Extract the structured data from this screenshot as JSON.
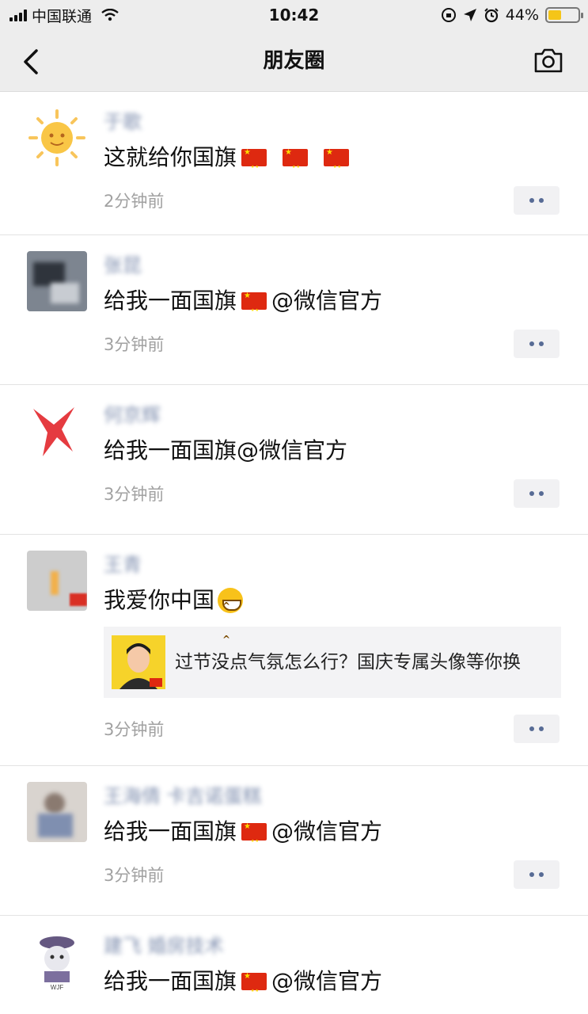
{
  "status_bar": {
    "carrier": "中国联通",
    "time": "10:42",
    "battery_text": "44%",
    "battery_level": 0.44
  },
  "nav": {
    "title": "朋友圈",
    "back_icon": "chevron-left-icon",
    "camera_icon": "camera-icon"
  },
  "posts": [
    {
      "author": "于歌",
      "content": "这就给你国旗",
      "flags": 3,
      "time": "2分钟前"
    },
    {
      "author": "张昆",
      "content_before": "给我一面国旗",
      "content_after": " @微信官方",
      "time": "3分钟前"
    },
    {
      "author": "何京辉",
      "content": "给我一面国旗@微信官方",
      "time": "3分钟前"
    },
    {
      "author": "王青",
      "content": "我爱你中国",
      "link_title": "过节没点气氛怎么行？国庆专属头像等你换",
      "time": "3分钟前"
    },
    {
      "author": "王海倩 卡吉诺蛋糕",
      "content_before": "给我一面国旗",
      "content_after": " @微信官方",
      "time": "3分钟前"
    },
    {
      "author": "建飞 婚房技术",
      "content_before": "给我一面国旗",
      "content_after": " @微信官方"
    }
  ],
  "colors": {
    "nav_bg": "#ededed",
    "link_blue": "#576b95",
    "time_gray": "#a1a1a1",
    "flag_red": "#de2910",
    "battery_yellow": "#f5c518"
  }
}
